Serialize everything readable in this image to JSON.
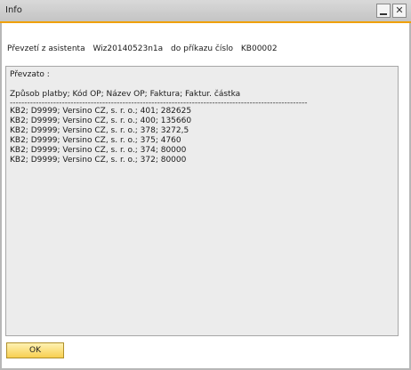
{
  "window": {
    "title": "Info",
    "minimize_label": "_",
    "close_label": "✕"
  },
  "message": {
    "prefix": "Převzetí z asistenta",
    "wizard": "Wiz20140523n1a",
    "middle": "do příkazu číslo",
    "order": "KB00002"
  },
  "result": {
    "heading": "Převzato :",
    "columns": "Způsob platby;  Kód OP;  Název OP;  Faktura;  Faktur. částka",
    "separator": "-------------------------------------------------------------------------------------------------------",
    "rows": [
      "KB2;  D9999;  Versino CZ, s. r. o.;  401;  282625",
      "KB2;  D9999;  Versino CZ, s. r. o.;  400;  135660",
      "KB2;  D9999;  Versino CZ, s. r. o.;  378;  3272,5",
      "KB2;  D9999;  Versino CZ, s. r. o.;  375;  4760",
      "KB2;  D9999;  Versino CZ, s. r. o.;  374;  80000",
      "KB2;  D9999;  Versino CZ, s. r. o.;  372;  80000"
    ]
  },
  "buttons": {
    "ok_label": "OK"
  }
}
